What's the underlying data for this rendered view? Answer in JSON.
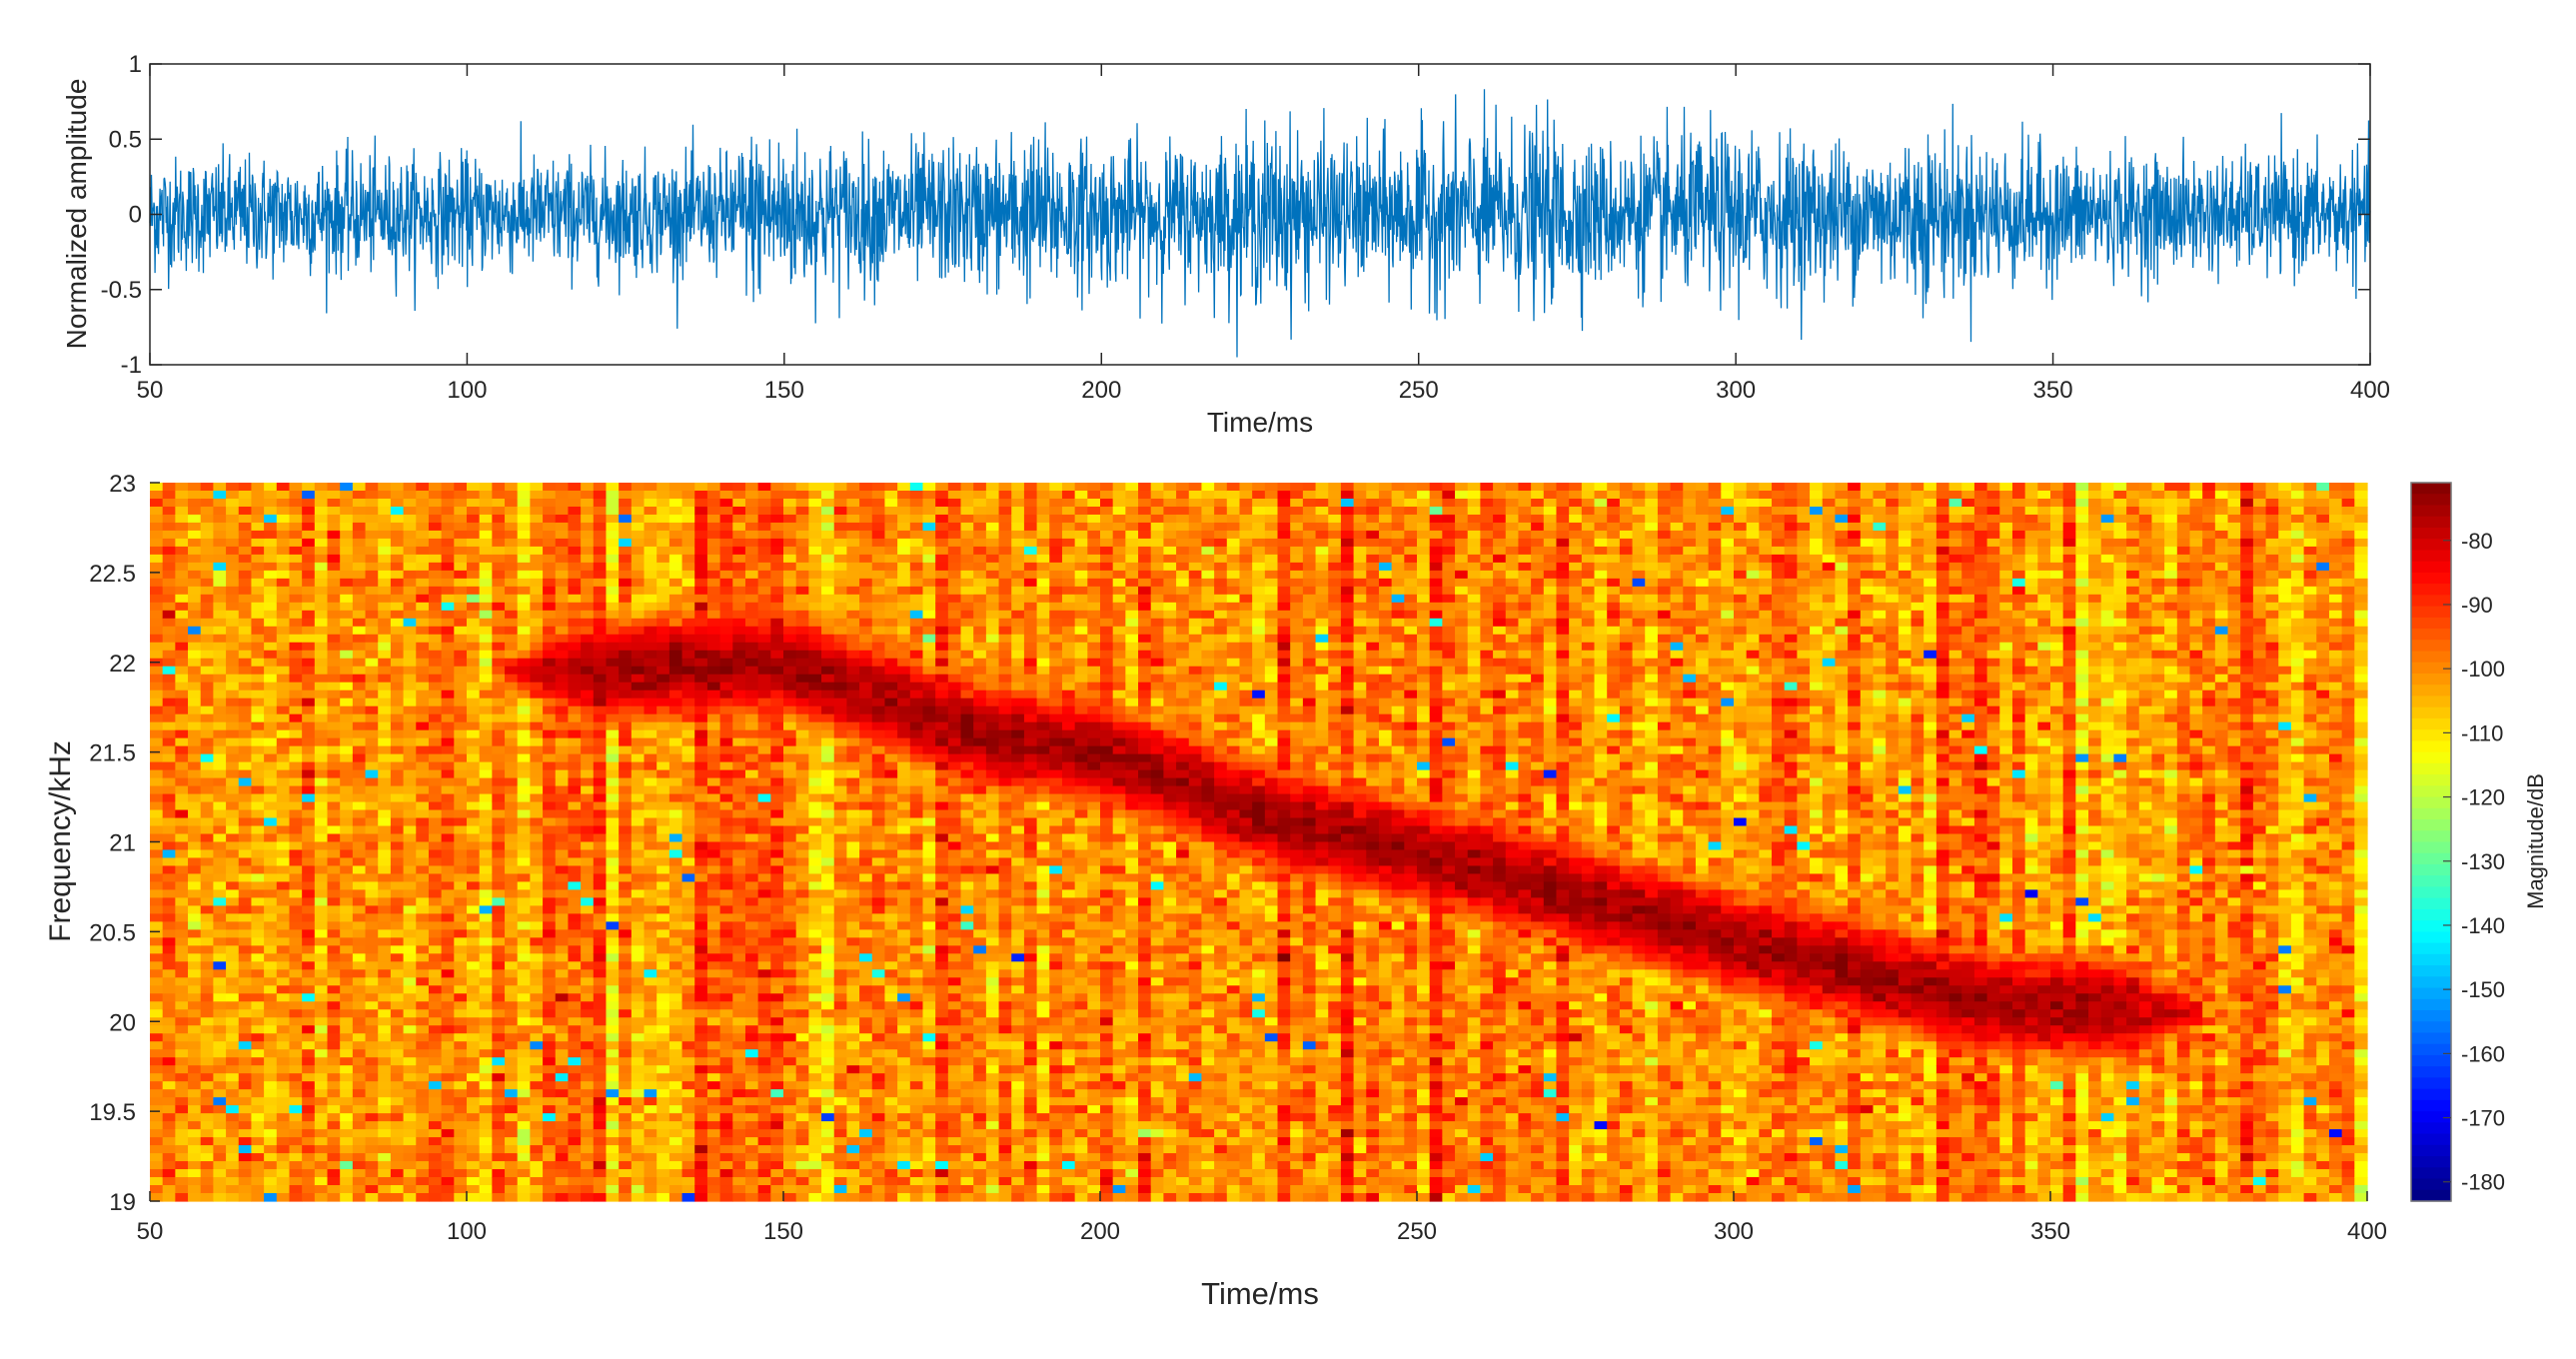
{
  "chart_data": [
    {
      "type": "line",
      "title": "",
      "xlabel": "Time/ms",
      "ylabel": "Normalized amplitude",
      "xlim": [
        50,
        400
      ],
      "ylim": [
        -1,
        1
      ],
      "xticks": [
        "50",
        "100",
        "150",
        "200",
        "250",
        "300",
        "350",
        "400"
      ],
      "yticks": [
        "1",
        "0.5",
        "0",
        "-0.5",
        "-1"
      ],
      "color": "#0072BD",
      "description_series": "dense noise-like waveform; envelope amplitude per time (ms)",
      "envelope": {
        "x": [
          50,
          100,
          140,
          146,
          160,
          180,
          190,
          200,
          215,
          228,
          240,
          255,
          270,
          280,
          300,
          320,
          330,
          350,
          370,
          400
        ],
        "y": [
          0.45,
          0.45,
          0.45,
          0.7,
          0.55,
          0.55,
          0.65,
          0.55,
          0.55,
          0.7,
          0.55,
          0.65,
          0.7,
          0.55,
          0.65,
          0.55,
          0.65,
          0.5,
          0.45,
          0.45
        ]
      }
    },
    {
      "type": "heatmap",
      "title": "",
      "xlabel": "Time/ms",
      "ylabel": "Frequency/kHz",
      "xlim": [
        50,
        400
      ],
      "ylim": [
        19,
        23
      ],
      "xticks": [
        "50",
        "100",
        "150",
        "200",
        "250",
        "300",
        "350",
        "400"
      ],
      "yticks": [
        "23",
        "22.5",
        "22",
        "21.5",
        "21",
        "20.5",
        "20",
        "19.5",
        "19"
      ],
      "colorbar": {
        "label": "Magnitude/dB",
        "colormap": "jet",
        "range": [
          -183,
          -71
        ],
        "ticks": [
          "-80",
          "-90",
          "-100",
          "-110",
          "-120",
          "-130",
          "-140",
          "-150",
          "-160",
          "-170",
          "-180"
        ]
      },
      "background_level_db": -100,
      "ridge": {
        "time_ms": [
          105,
          120,
          150,
          180,
          200,
          225,
          260,
          300,
          340,
          375
        ],
        "frequency_khz": [
          21.95,
          21.95,
          22.0,
          21.6,
          21.5,
          21.15,
          20.85,
          20.45,
          20.1,
          20.05
        ],
        "peak_db": -75
      }
    }
  ]
}
